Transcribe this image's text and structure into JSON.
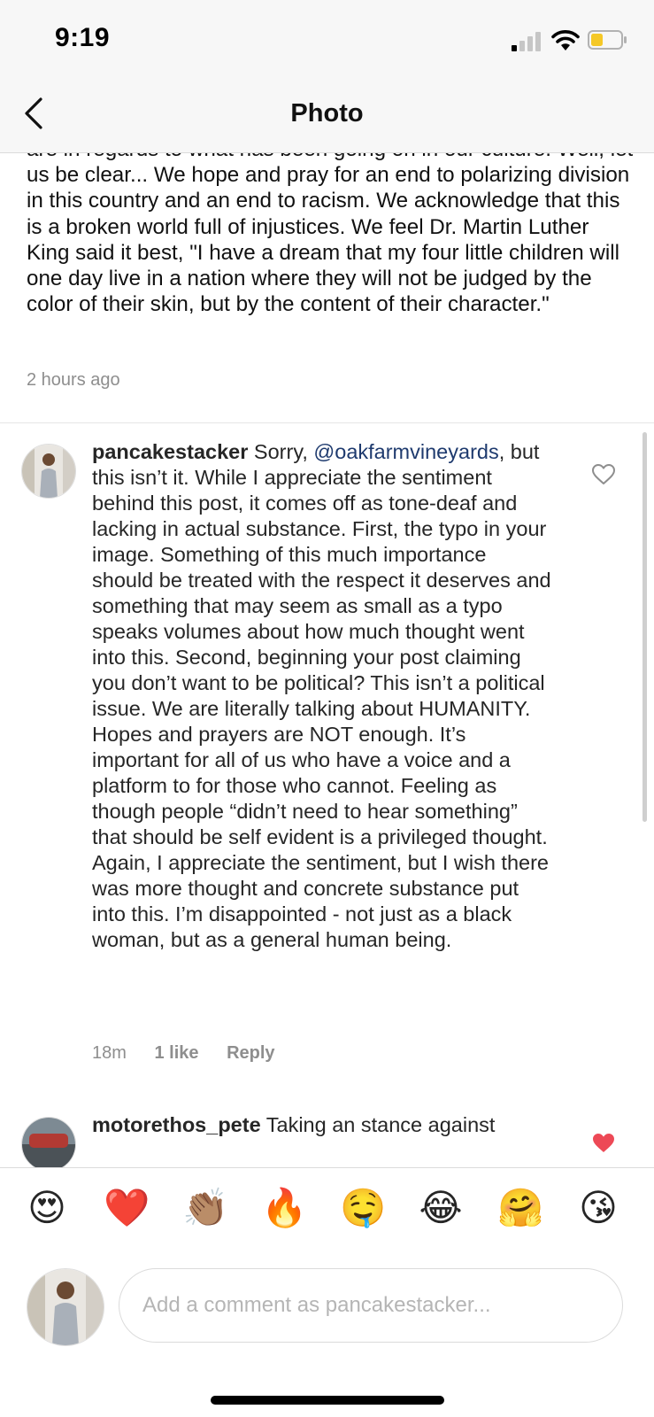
{
  "status_bar": {
    "time": "9:19"
  },
  "nav": {
    "title": "Photo"
  },
  "caption": {
    "text": "are in regards to what has been going on in our culture. Well, let us be clear... We hope and pray for an end to polarizing division in this country and an end to racism. We acknowledge that this is a broken world full of injustices. We feel Dr. Martin Luther King said it best, \"I have a dream that my four little children will one day live in a nation where they will not be judged by the color of their skin, but by the content of their character.\"",
    "timestamp": "2 hours ago"
  },
  "comments": [
    {
      "username": "pancakestacker",
      "text_before_mention": "Sorry, ",
      "mention": "@oakfarmvineyards",
      "text_after_mention": ", but this isn’t it. While I appreciate the sentiment behind this post, it comes off as tone-deaf and lacking in actual substance. First, the typo in your image. Something of this much importance should be treated with the respect it deserves and something that may seem as small as a typo speaks volumes about how much thought went into this. Second, beginning your post claiming you don’t want to be political? This isn’t a political issue. We are literally talking about HUMANITY. Hopes and prayers are NOT enough. It’s important for all of us who have a voice and a platform to for those who cannot. Feeling as though people “didn’t need to hear something” that should be self evident is a privileged thought. Again, I appreciate the sentiment, but I wish there was more thought and concrete substance put into this. I’m disappointed - not just as a black woman, but as a general human being.",
      "time": "18m",
      "likes": "1 like",
      "reply_label": "Reply",
      "liked": false
    },
    {
      "username": "motorethos_pete",
      "text": "Taking an stance against",
      "liked": true
    }
  ],
  "emoji_bar": [
    "😍",
    "❤️",
    "👏🏽",
    "🔥",
    "🤤",
    "😂",
    "🤗",
    "😘"
  ],
  "comment_input": {
    "placeholder": "Add a comment as pancakestacker..."
  },
  "colors": {
    "mention": "#1e3a6e",
    "muted": "#8e8e8e",
    "like_red": "#ed4956",
    "battery": "#f5c826"
  }
}
